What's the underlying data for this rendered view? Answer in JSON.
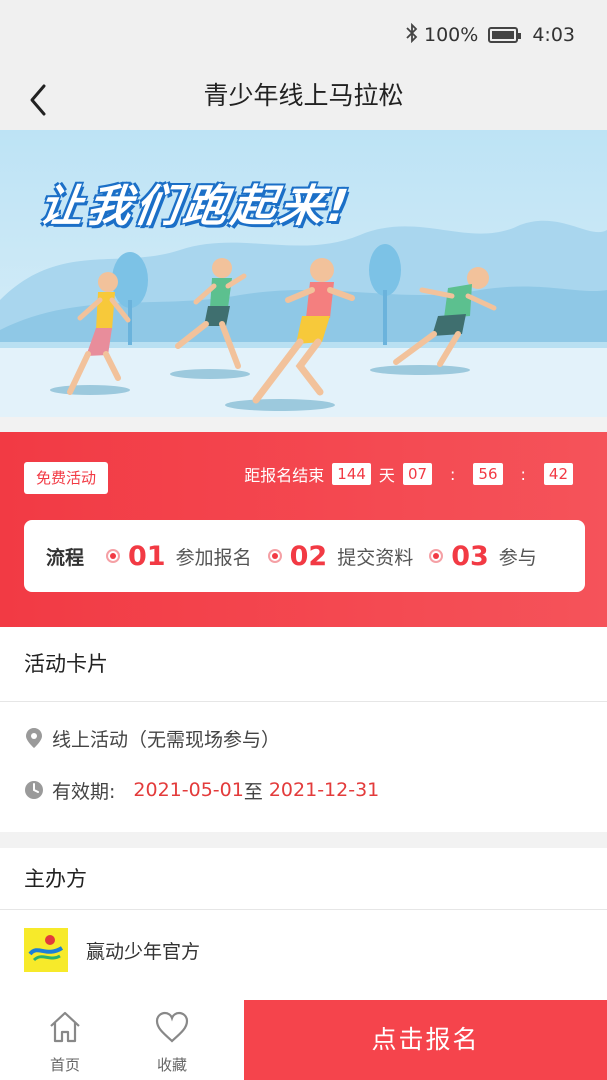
{
  "status_bar": {
    "battery": "100%",
    "battery_level": 1.0,
    "time": "4:03",
    "icons": [
      "bluetooth-icon",
      "battery-icon"
    ]
  },
  "nav": {
    "title": "青少年线上马拉松",
    "back_icon": "chevron-left-icon"
  },
  "banner": {
    "slogan": "让我们跑起来!"
  },
  "event": {
    "free_tag": "免费活动",
    "countdown_label": "距报名结束",
    "days": "144",
    "days_unit": "天",
    "hours": "07",
    "minutes": "56",
    "seconds": "42",
    "separator": ":"
  },
  "process": {
    "label": "流程",
    "steps": [
      {
        "num": "01",
        "label": "参加报名"
      },
      {
        "num": "02",
        "label": "提交资料"
      },
      {
        "num": "03",
        "label": "参与"
      }
    ]
  },
  "activity_card": {
    "title": "活动卡片",
    "location": "线上活动（无需现场参与）",
    "validity_label": "有效期:",
    "start_date": "2021-05-01",
    "date_separator": "至",
    "end_date": "2021-12-31"
  },
  "organizer": {
    "title": "主办方",
    "name": "赢动少年官方"
  },
  "bottom_bar": {
    "home": "首页",
    "favorite": "收藏",
    "signup": "点击报名"
  },
  "colors": {
    "accent": "#f23a44",
    "banner_sky": "#bde3f5",
    "logo_yellow": "#f7ea2a"
  }
}
